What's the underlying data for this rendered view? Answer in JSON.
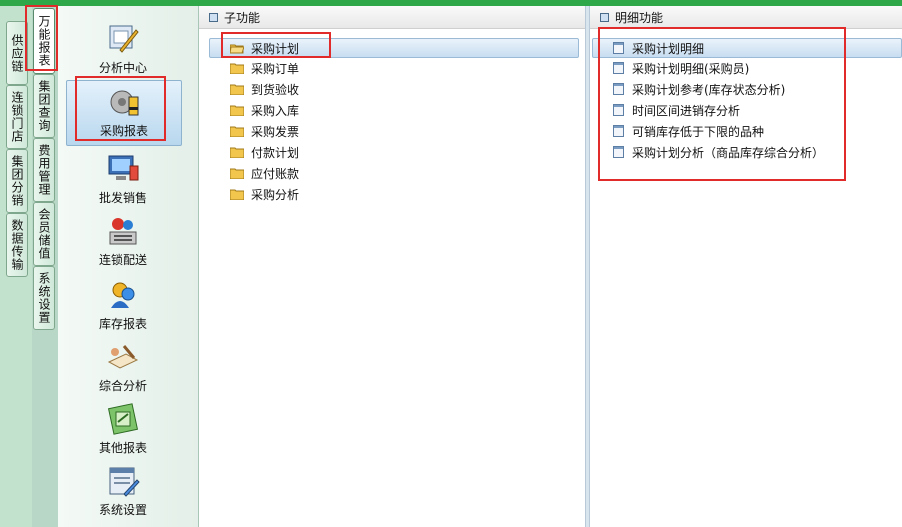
{
  "outer_tabs": [
    {
      "label": "供应链"
    },
    {
      "label": "连锁门店"
    },
    {
      "label": "集团分销"
    },
    {
      "label": "数据传输"
    }
  ],
  "inner_tabs": [
    {
      "label": "万能报表"
    },
    {
      "label": "集团查询"
    },
    {
      "label": "费用管理"
    },
    {
      "label": "会员储值"
    },
    {
      "label": "系统设置"
    }
  ],
  "modules": [
    {
      "label": "分析中心",
      "icon": "analysis-center-icon"
    },
    {
      "label": "采购报表",
      "icon": "purchase-report-icon"
    },
    {
      "label": "批发销售",
      "icon": "wholesale-icon"
    },
    {
      "label": "连锁配送",
      "icon": "chain-delivery-icon"
    },
    {
      "label": "库存报表",
      "icon": "inventory-report-icon"
    },
    {
      "label": "综合分析",
      "icon": "comprehensive-analysis-icon"
    },
    {
      "label": "其他报表",
      "icon": "other-reports-icon"
    },
    {
      "label": "系统设置",
      "icon": "system-settings-icon"
    }
  ],
  "sub_panel": {
    "title": "子功能",
    "items": [
      {
        "label": "采购计划"
      },
      {
        "label": "采购订单"
      },
      {
        "label": "到货验收"
      },
      {
        "label": "采购入库"
      },
      {
        "label": "采购发票"
      },
      {
        "label": "付款计划"
      },
      {
        "label": "应付账款"
      },
      {
        "label": "采购分析"
      }
    ]
  },
  "detail_panel": {
    "title": "明细功能",
    "items": [
      {
        "label": "采购计划明细"
      },
      {
        "label": "采购计划明细(采购员)"
      },
      {
        "label": "采购计划参考(库存状态分析)"
      },
      {
        "label": "时间区间进销存分析"
      },
      {
        "label": "可销库存低于下限的品种"
      },
      {
        "label": "采购计划分析（商品库存综合分析）"
      }
    ]
  },
  "colors": {
    "highlight": "#e12b2b",
    "accent": "#2fa84a"
  }
}
